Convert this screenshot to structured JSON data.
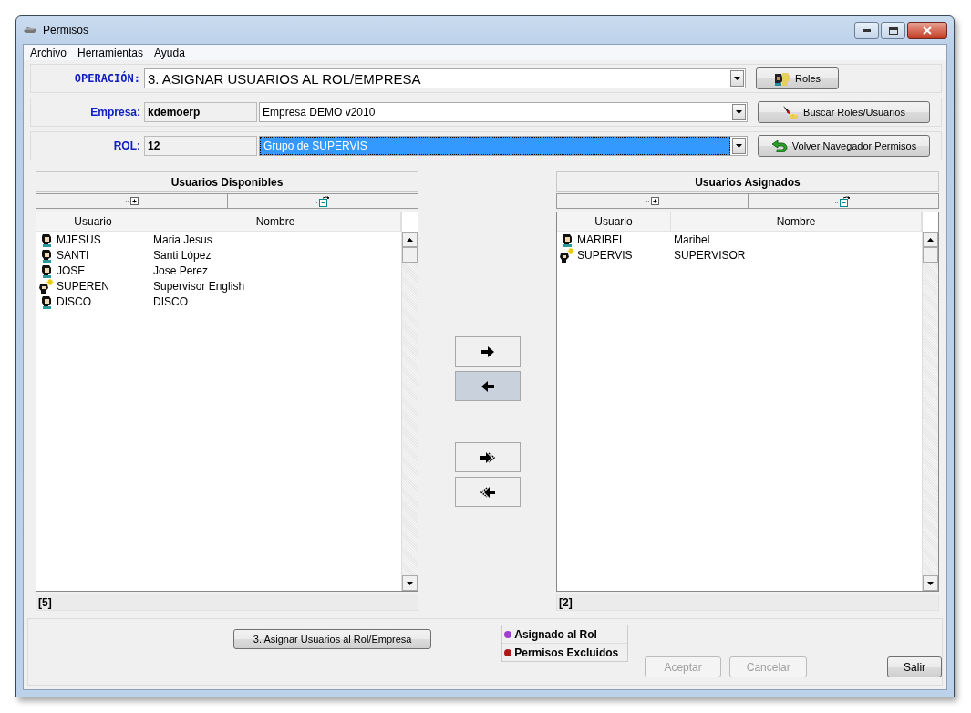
{
  "window": {
    "title": "Permisos"
  },
  "menu": [
    "Archivo",
    "Herramientas",
    "Ayuda"
  ],
  "operation": {
    "label": "OPERACIÓN:",
    "value": "3. ASIGNAR USUARIOS AL ROL/EMPRESA",
    "button": "Roles"
  },
  "empresa": {
    "label": "Empresa:",
    "code": "kdemoerp",
    "value": "Empresa DEMO v2010",
    "selected": false,
    "button": "Buscar Roles/Usuarios"
  },
  "rol": {
    "label": "ROL:",
    "code": "12",
    "value": "Grupo de SUPERVIS",
    "selected": true,
    "button": "Volver Navegador Permisos"
  },
  "lists": [
    {
      "title": "Usuarios Disponibles",
      "columns": [
        "Usuario",
        "Nombre"
      ],
      "count": "[5]",
      "rows": [
        {
          "kind": "user",
          "usuario": "MJESUS",
          "nombre": "Maria Jesus"
        },
        {
          "kind": "user",
          "usuario": "SANTI",
          "nombre": "Santi López"
        },
        {
          "kind": "user",
          "usuario": "JOSE",
          "nombre": "Jose Perez"
        },
        {
          "kind": "supervisor",
          "usuario": "SUPEREN",
          "nombre": "Supervisor English"
        },
        {
          "kind": "user",
          "usuario": "DISCO",
          "nombre": "DISCO"
        }
      ]
    },
    {
      "title": "Usuarios Asignados",
      "columns": [
        "Usuario",
        "Nombre"
      ],
      "count": "[2]",
      "rows": [
        {
          "kind": "user",
          "usuario": "MARIBEL",
          "nombre": "Maribel"
        },
        {
          "kind": "supervisor",
          "usuario": "SUPERVIS",
          "nombre": "SUPERVISOR"
        }
      ]
    }
  ],
  "transfer_buttons": [
    {
      "kind": "right",
      "selected": false
    },
    {
      "kind": "left",
      "selected": true
    },
    {
      "kind": "all-right",
      "selected": false
    },
    {
      "kind": "all-left",
      "selected": false
    }
  ],
  "action_button": "3. Asignar Usuarios al Rol/Empresa",
  "legend": [
    {
      "label": "Asignado al Rol",
      "color": "#a040d0"
    },
    {
      "label": "Permisos Excluidos",
      "color": "#b01818"
    }
  ],
  "footer_buttons": [
    {
      "label": "Aceptar",
      "disabled": true
    },
    {
      "label": "Cancelar",
      "disabled": true
    },
    {
      "label": "Salir",
      "disabled": false
    }
  ]
}
